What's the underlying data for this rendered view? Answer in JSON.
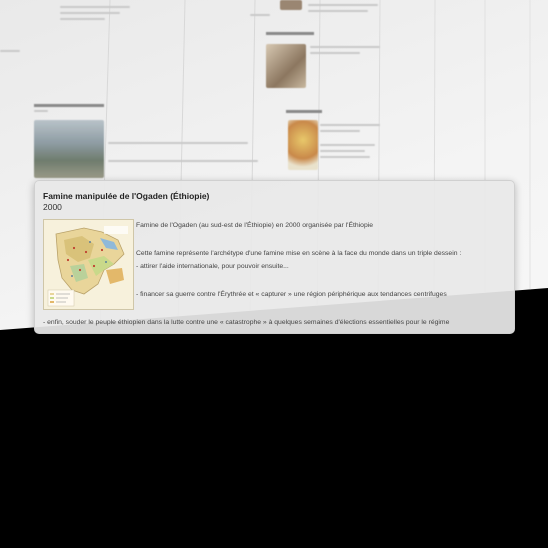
{
  "event": {
    "title": "Famine manipulée de l'Ogaden (Éthiopie)",
    "date": "2000",
    "image_icon": "ethiopia-map-image",
    "summary": "Famine de l'Ogaden (au sud-est de l'Éthiopie) en 2000 organisée par l'Éthiopie",
    "para1": "Cette famine représente l'archétype d'une famine mise en scène à la face du monde dans un triple dessein :",
    "para2": "- attirer l'aide internationale, pour pouvoir ensuite...",
    "para3": "- financer sa guerre contre l'Érythrée et « capturer » une région périphérique aux tendances centrifuges",
    "para4": "- enfin, souder le peuple éthiopien dans la lutte contre une « catastrophe » à quelques semaines d'élections essentielles pour le régime"
  },
  "colors": {
    "popup_bg": "#e8e8e8",
    "wall_bg": "#f2f2f2",
    "outside_bg": "#000000"
  }
}
